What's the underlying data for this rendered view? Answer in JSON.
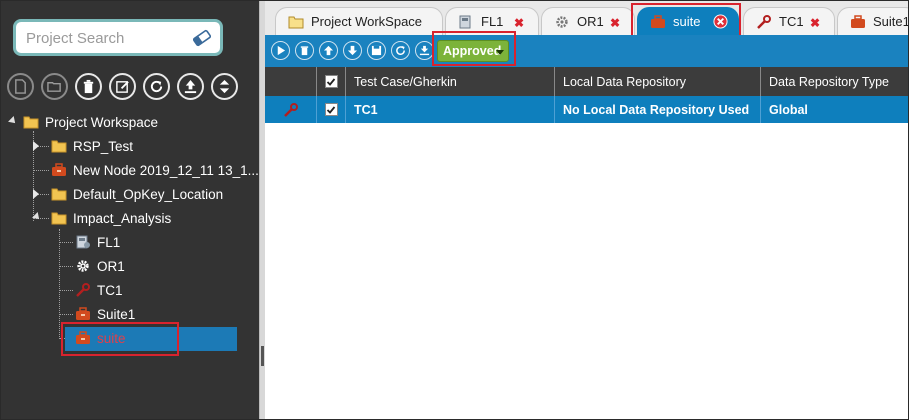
{
  "search": {
    "placeholder": "Project Search"
  },
  "left_toolbar": {
    "buttons": [
      "new-file",
      "open-folder",
      "delete",
      "edit",
      "refresh",
      "upload",
      "sort"
    ]
  },
  "tree": {
    "root": "Project Workspace",
    "items": [
      {
        "label": "RSP_Test",
        "type": "folder"
      },
      {
        "label": "New Node 2019_12_11 13_1...",
        "type": "suite"
      },
      {
        "label": "Default_OpKey_Location",
        "type": "folder"
      },
      {
        "label": "Impact_Analysis",
        "type": "folder"
      }
    ],
    "children": [
      {
        "label": "FL1",
        "type": "function-library"
      },
      {
        "label": "OR1",
        "type": "object-repository"
      },
      {
        "label": "TC1",
        "type": "test-case"
      },
      {
        "label": "Suite1",
        "type": "suite"
      },
      {
        "label": "suite",
        "type": "suite",
        "selected": true
      }
    ]
  },
  "tabs": [
    {
      "label": "Project WorkSpace",
      "icon": "folder-icon",
      "closable": false
    },
    {
      "label": "FL1",
      "icon": "function-library-icon",
      "closable": true
    },
    {
      "label": "OR1",
      "icon": "gear-icon",
      "closable": true
    },
    {
      "label": "suite",
      "icon": "suite-icon",
      "closable": true,
      "active": true
    },
    {
      "label": "TC1",
      "icon": "wrench-icon",
      "closable": true
    },
    {
      "label": "Suite1",
      "icon": "suite-icon",
      "closable": false
    }
  ],
  "toolbar": {
    "status": "Approved"
  },
  "grid": {
    "columns": [
      "",
      "",
      "Test Case/Gherkin",
      "Local Data Repository",
      "Data Repository Type"
    ],
    "rows": [
      {
        "test_case": "TC1",
        "local_repo": "No Local Data Repository Used",
        "repo_type": "Global",
        "checked": true
      }
    ]
  },
  "colors": {
    "panel_bg": "#333333",
    "accent_blue": "#0e7fbd",
    "approved_green": "#7cb33a",
    "highlight_red": "#d9232e"
  }
}
